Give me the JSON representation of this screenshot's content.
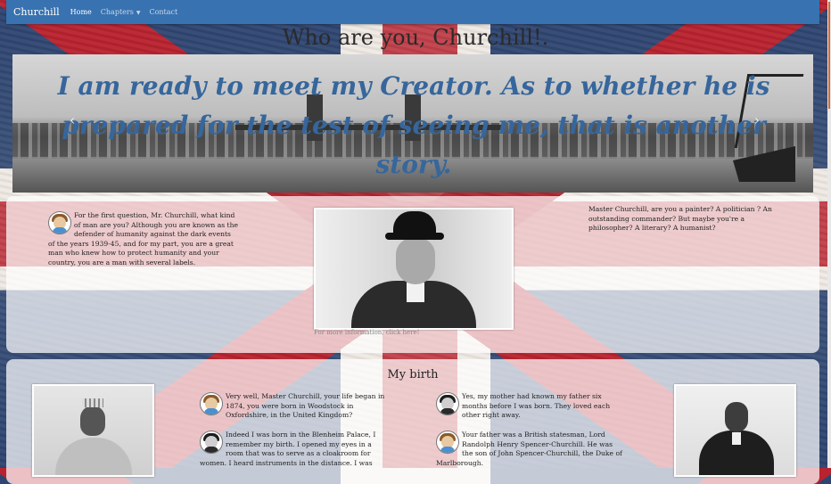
{
  "navbar": {
    "brand": "Churchill",
    "links": [
      {
        "label": "Home"
      },
      {
        "label": "Chapters"
      },
      {
        "label": "Contact"
      }
    ]
  },
  "page_title": "Who are you, Churchill!.",
  "carousel": {
    "quote": "I am ready to meet my Creator. As to whether he is prepared for the test of seeing me, that is another story.",
    "prev_icon": "‹",
    "next_icon": "›"
  },
  "intro": {
    "left_text": "For the first question, Mr. Churchill, what kind of man are you? Although you are known as the defender of humanity against the dark events of the years 1939-45, and for my part, you are a great man who knew how to protect humanity and your country, you are a man with several labels.",
    "right_text": "Master Churchill, are you a painter? A politician ? An outstanding commander? But maybe you're a philosopher? A literary? A humanist?",
    "photo_caption": "For more information, click here!"
  },
  "birth": {
    "title": "My birth",
    "messages": [
      {
        "avatar": "interviewer-avatar",
        "text": "Very well, Master Churchill, your life began in 1874, you were born in Woodstock in Oxfordshire, in the United Kingdom?"
      },
      {
        "avatar": "churchill-avatar",
        "text": "Indeed I was born in the Blenheim Palace, I remember my birth. I opened my eyes in a room that was to serve as a cloakroom for women. I heard instruments in the distance. I was"
      },
      {
        "avatar": "churchill-avatar",
        "text": "Yes, my mother had known my father six months before I was born. They loved each other right away."
      },
      {
        "avatar": "interviewer-avatar",
        "text": "Your father was a British statesman, Lord Randolph Henry Spencer-Churchill. He was the son of John Spencer-Churchill, the Duke of Marlborough."
      }
    ]
  }
}
